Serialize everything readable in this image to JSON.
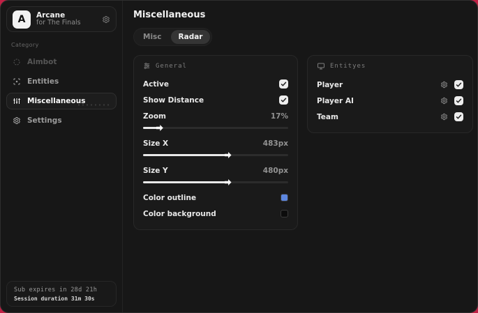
{
  "window": {
    "accent_background": "#c12045"
  },
  "sidebar": {
    "profile": {
      "initial": "A",
      "title": "Arcane",
      "subtitle": "for The Finals"
    },
    "category_label": "Category",
    "items": [
      {
        "label": "Aimbot",
        "icon": "crosshair-icon",
        "state": "disabled"
      },
      {
        "label": "Entities",
        "icon": "entities-icon",
        "state": "normal"
      },
      {
        "label": "Miscellaneous",
        "icon": "sliders-icon",
        "state": "active"
      },
      {
        "label": "Settings",
        "icon": "gear-icon",
        "state": "normal"
      }
    ],
    "subscription": {
      "line1": "Sub expires in 28d 21h",
      "line2": "Session duration 31m 30s"
    }
  },
  "main": {
    "title": "Miscellaneous",
    "tabs": [
      {
        "label": "Misc",
        "active": false
      },
      {
        "label": "Radar",
        "active": true
      }
    ],
    "general_panel": {
      "title": "General",
      "active": {
        "label": "Active",
        "checked": true
      },
      "show_distance": {
        "label": "Show Distance",
        "checked": true
      },
      "zoom": {
        "label": "Zoom",
        "value": "17%",
        "fill_pct": 10
      },
      "size_x": {
        "label": "Size X",
        "value": "483px",
        "fill_pct": 57
      },
      "size_y": {
        "label": "Size Y",
        "value": "480px",
        "fill_pct": 57
      },
      "color_outline": {
        "label": "Color outline",
        "swatch": "#5d87e0"
      },
      "color_background": {
        "label": "Color background",
        "swatch": "#0c0c0c"
      }
    },
    "entities_panel": {
      "title": "Entityes",
      "rows": [
        {
          "label": "Player",
          "checked": true
        },
        {
          "label": "Player AI",
          "checked": true
        },
        {
          "label": "Team",
          "checked": true
        }
      ]
    }
  }
}
